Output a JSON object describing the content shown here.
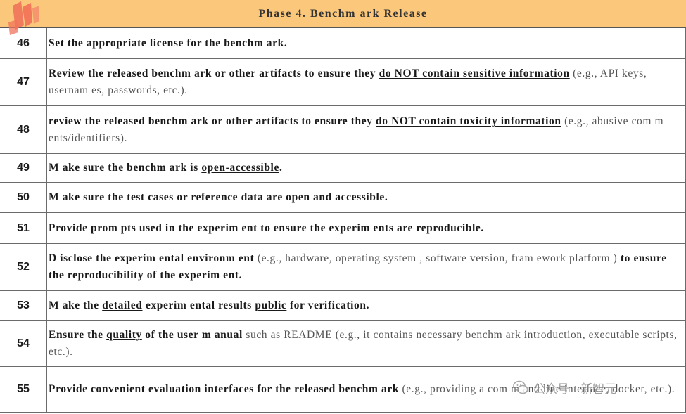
{
  "header": {
    "title": "Phase 4. Benchm ark Release"
  },
  "rows": [
    {
      "num": "46",
      "parts": [
        {
          "t": "Set the appropriate ",
          "s": "b"
        },
        {
          "t": "license",
          "s": "b u"
        },
        {
          "t": " for the benchm ark.",
          "s": "b"
        }
      ]
    },
    {
      "num": "47",
      "parts": [
        {
          "t": "Review  the released benchm ark or other artifacts to ensure they ",
          "s": "b"
        },
        {
          "t": "do NOT contain sensitive information",
          "s": "b u"
        },
        {
          "t": " (e.g., API keys, usernam es, passwords, etc.).",
          "s": "n"
        }
      ]
    },
    {
      "num": "48",
      "parts": [
        {
          "t": "review  the released benchm ark or other artifacts to ensure they ",
          "s": "b"
        },
        {
          "t": "do NOT contain toxicity information",
          "s": "b u"
        },
        {
          "t": " (e.g., abusive com m ents/identifiers).",
          "s": "n"
        }
      ]
    },
    {
      "num": "49",
      "parts": [
        {
          "t": "M ake sure the benchm ark is ",
          "s": "b"
        },
        {
          "t": "open-accessible",
          "s": "b u"
        },
        {
          "t": ".",
          "s": "b"
        }
      ]
    },
    {
      "num": "50",
      "parts": [
        {
          "t": "M ake sure the ",
          "s": "b"
        },
        {
          "t": "test cases",
          "s": "b u"
        },
        {
          "t": " or ",
          "s": "b"
        },
        {
          "t": "reference data",
          "s": "b u"
        },
        {
          "t": " are open and accessible.",
          "s": "b"
        }
      ]
    },
    {
      "num": "51",
      "parts": [
        {
          "t": "Provide prom pts",
          "s": "b u"
        },
        {
          "t": " used in the experim ent to ensure the experim ents are reproducible.",
          "s": "b"
        }
      ]
    },
    {
      "num": "52",
      "parts": [
        {
          "t": "D isclose the experim ental environm ent ",
          "s": "b"
        },
        {
          "t": "(e.g., hardware, operating system , software version, fram ework platform ) ",
          "s": "n"
        },
        {
          "t": "to ensure the reproducibility of the experim ent.",
          "s": "b"
        }
      ]
    },
    {
      "num": "53",
      "parts": [
        {
          "t": "M ake the ",
          "s": "b"
        },
        {
          "t": "detailed",
          "s": "b u"
        },
        {
          "t": " experim ental results ",
          "s": "b"
        },
        {
          "t": "public",
          "s": "b u"
        },
        {
          "t": " for verification.",
          "s": "b"
        }
      ]
    },
    {
      "num": "54",
      "parts": [
        {
          "t": "Ensure the ",
          "s": "b"
        },
        {
          "t": "quality",
          "s": "b u"
        },
        {
          "t": " of the user m anual ",
          "s": "b"
        },
        {
          "t": "such as README (e.g., it contains necessary benchm ark introduction, executable scripts, etc.).",
          "s": "n"
        }
      ]
    },
    {
      "num": "55",
      "parts": [
        {
          "t": "Provide ",
          "s": "b"
        },
        {
          "t": "convenient evaluation interfaces",
          "s": "b u"
        },
        {
          "t": " for the released benchm ark ",
          "s": "b"
        },
        {
          "t": "(e.g., providing a com m and line interface, docker, etc.).",
          "s": "n"
        }
      ]
    }
  ],
  "watermark": {
    "text": "公众号 · 新智元"
  }
}
